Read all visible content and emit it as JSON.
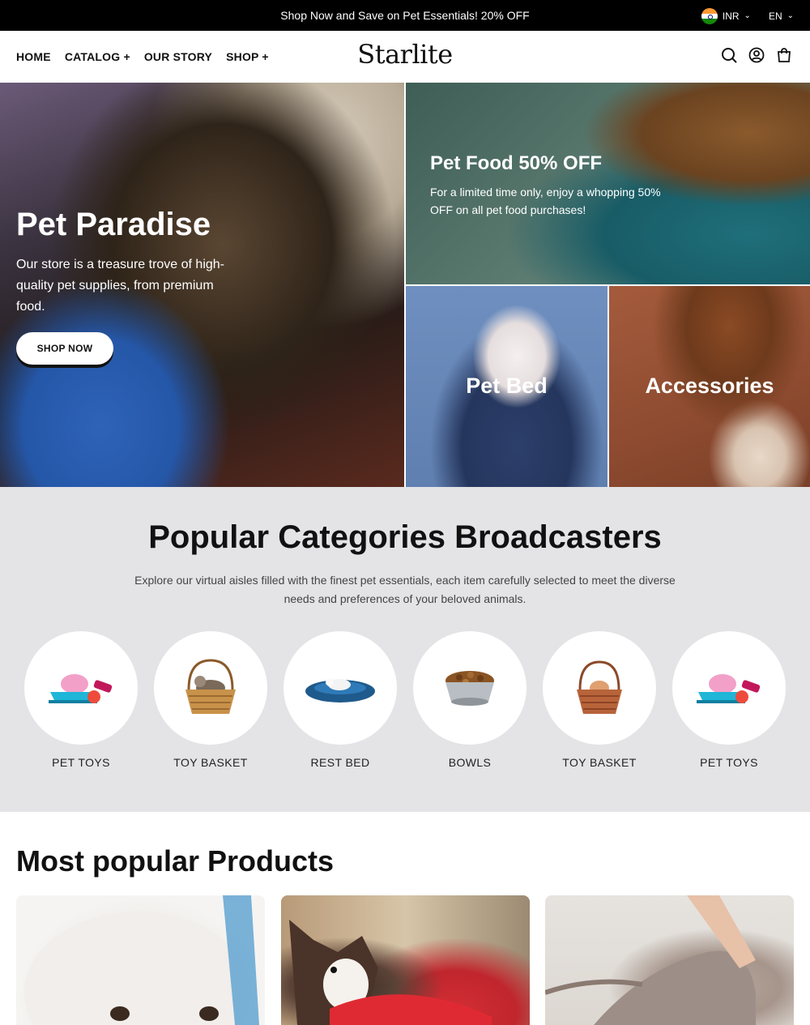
{
  "announcement": {
    "message": "Shop Now and Save on Pet Essentials! 20% OFF",
    "currency": "INR",
    "language": "EN"
  },
  "header": {
    "logo": "Starlite",
    "nav": [
      {
        "label": "HOME"
      },
      {
        "label": "CATALOG +"
      },
      {
        "label": "OUR STORY"
      },
      {
        "label": "SHOP +"
      }
    ],
    "icons": [
      "search-icon",
      "account-icon",
      "cart-icon"
    ]
  },
  "hero": {
    "main": {
      "title": "Pet Paradise",
      "text": "Our store is a treasure trove of high-quality pet supplies, from premium food.",
      "button": "SHOP NOW"
    },
    "food": {
      "title": "Pet Food 50% OFF",
      "text": "For a limited time only, enjoy a whopping 50% OFF on all pet food purchases!"
    },
    "bed": {
      "label": "Pet Bed"
    },
    "accessories": {
      "label": "Accessories"
    }
  },
  "categories": {
    "title": "Popular Categories Broadcasters",
    "description": "Explore our virtual aisles filled with the finest pet essentials, each item carefully selected to meet the diverse needs and preferences of your beloved animals.",
    "items": [
      {
        "name": "PET TOYS",
        "icon": "pet-toys-icon"
      },
      {
        "name": "TOY BASKET",
        "icon": "basket-cat-icon"
      },
      {
        "name": "REST BED",
        "icon": "pet-bed-icon"
      },
      {
        "name": "BOWLS",
        "icon": "food-bowl-icon"
      },
      {
        "name": "TOY BASKET",
        "icon": "basket-hamster-icon"
      },
      {
        "name": "PET TOYS",
        "icon": "pet-toys-icon"
      }
    ]
  },
  "popular": {
    "title": "Most popular Products"
  },
  "colors": {
    "announce_bg": "#000000",
    "category_bg": "#e4e4e7",
    "text_dark": "#111111"
  }
}
